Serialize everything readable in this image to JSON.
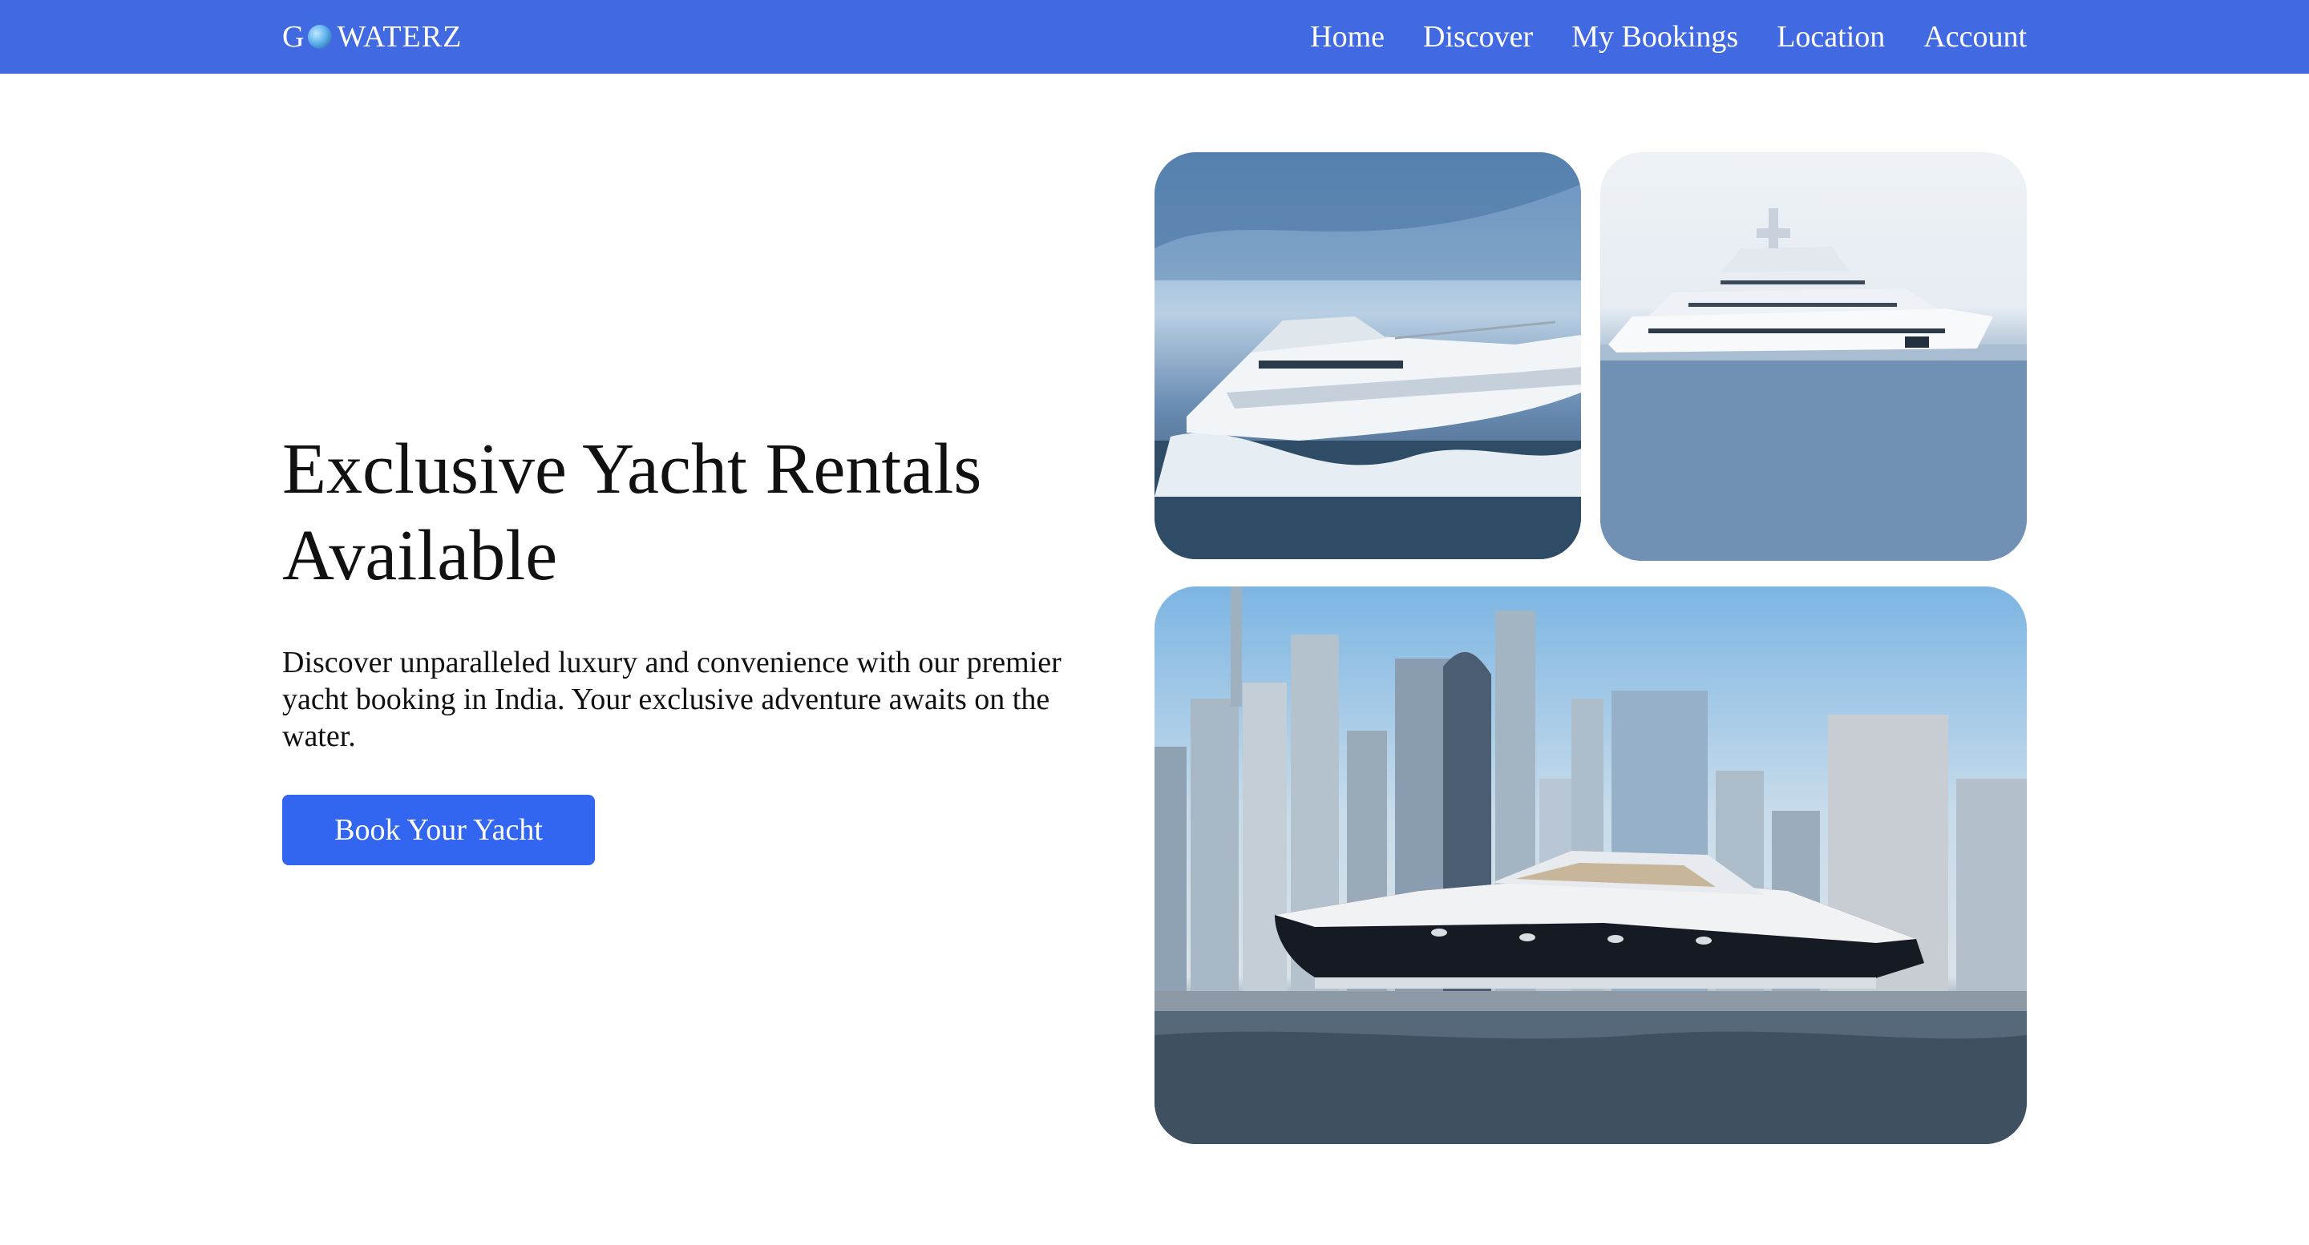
{
  "brand": {
    "logo_text_left": "G",
    "logo_text_right": "WATERZ"
  },
  "nav": {
    "items": [
      {
        "label": "Home"
      },
      {
        "label": "Discover"
      },
      {
        "label": "My Bookings"
      },
      {
        "label": "Location"
      },
      {
        "label": "Account"
      }
    ]
  },
  "hero": {
    "title": "Exclusive Yacht Rentals Available",
    "description": "Discover unparalleled luxury and convenience with our premier yacht booking in India. Your exclusive adventure awaits on the water.",
    "cta_label": "Book Your Yacht"
  },
  "colors": {
    "nav_background": "#4169e1",
    "cta_background": "#3366f0",
    "text": "#111111"
  }
}
